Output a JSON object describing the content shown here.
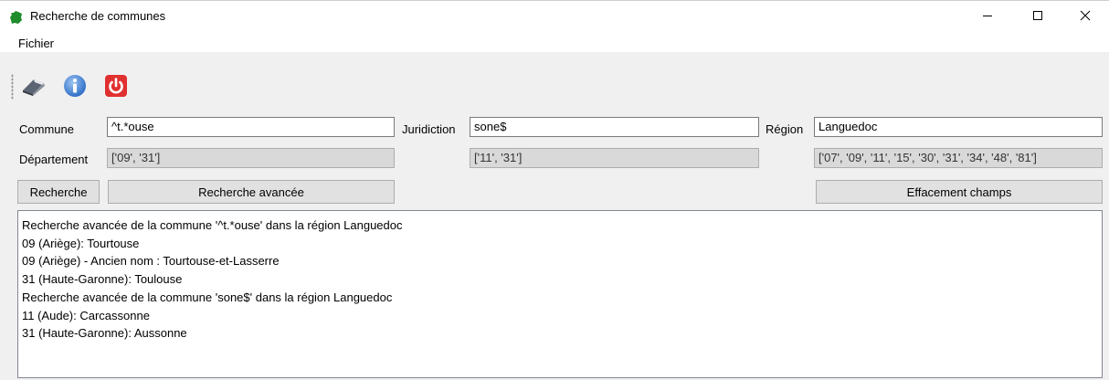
{
  "window": {
    "title": "Recherche de communes",
    "app_icon": "france-map-icon",
    "controls": [
      "minimize-icon",
      "maximize-icon",
      "close-icon"
    ]
  },
  "menubar": {
    "items": [
      "Fichier"
    ]
  },
  "toolbar": {
    "buttons": [
      {
        "icon": "eraser-icon"
      },
      {
        "icon": "info-icon",
        "color": "#3a7bd5"
      },
      {
        "icon": "power-icon",
        "color": "#e03030"
      }
    ]
  },
  "form": {
    "commune_label": "Commune",
    "commune_value": "^t.*ouse",
    "juridiction_label": "Juridiction",
    "juridiction_value": "sone$",
    "region_label": "Région",
    "region_value": "Languedoc",
    "departement_label": "Département",
    "departement_commune": "['09', '31']",
    "departement_juridiction": "['11', '31']",
    "departement_region": "['07', '09', '11', '15', '30', '31', '34', '48', '81']"
  },
  "buttons": {
    "recherche": "Recherche",
    "recherche_avancee": "Recherche avancée",
    "effacement": "Effacement champs"
  },
  "output": {
    "lines": [
      "Recherche avancée de la commune '^t.*ouse' dans la région Languedoc",
      "09 (Ariège): Tourtouse",
      "09 (Ariège) - Ancien nom : Tourtouse-et-Lasserre",
      "31 (Haute-Garonne): Toulouse",
      "Recherche avancée de la commune 'sone$' dans la région Languedoc",
      "11 (Aude): Carcassonne",
      "31 (Haute-Garonne): Aussonne"
    ]
  }
}
